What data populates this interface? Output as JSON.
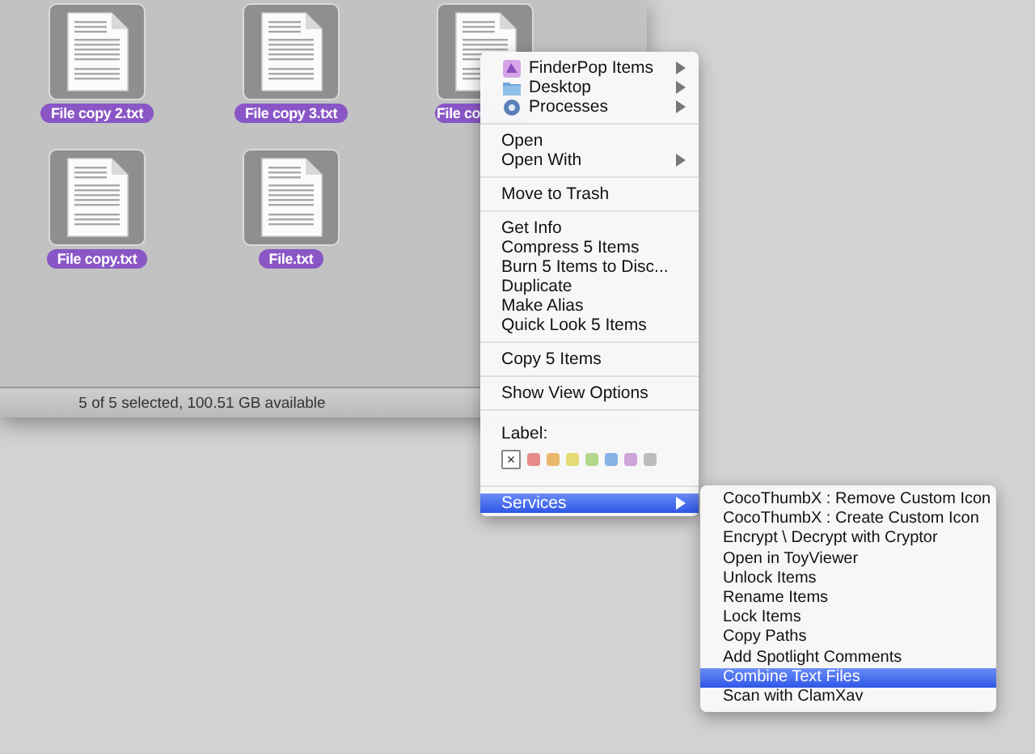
{
  "files": [
    {
      "name": "File copy 2.txt",
      "selected": true
    },
    {
      "name": "File copy 3.txt",
      "selected": true
    },
    {
      "name": "File co",
      "selected": true,
      "kind": "covered"
    },
    {
      "name": "File copy.txt",
      "selected": true
    },
    {
      "name": "File.txt",
      "selected": true
    }
  ],
  "status_bar": "5 of 5 selected, 100.51 GB available",
  "context_menu": {
    "sections": [
      [
        {
          "label": "FinderPop Items",
          "has_submenu": true,
          "selected": false
        },
        {
          "label": "Desktop",
          "has_submenu": true,
          "selected": false
        },
        {
          "label": "Processes",
          "has_submenu": true,
          "selected": false
        }
      ],
      [
        {
          "label": "Open",
          "has_submenu": false,
          "selected": false
        },
        {
          "label": "Open With",
          "has_submenu": true,
          "selected": false
        }
      ],
      [
        {
          "label": "Move to Trash",
          "has_submenu": false,
          "selected": false
        }
      ],
      [
        {
          "label": "Get Info",
          "has_submenu": false,
          "selected": false
        },
        {
          "label": "Compress 5 Items",
          "has_submenu": false,
          "selected": false
        },
        {
          "label": "Burn 5 Items to Disc...",
          "has_submenu": false,
          "selected": false
        },
        {
          "label": "Duplicate",
          "has_submenu": false,
          "selected": false
        },
        {
          "label": "Make Alias",
          "has_submenu": false,
          "selected": false
        },
        {
          "label": "Quick Look 5 Items",
          "has_submenu": false,
          "selected": false
        }
      ],
      [
        {
          "label": "Copy 5 Items",
          "has_submenu": false,
          "selected": false
        }
      ],
      [
        {
          "label": "Show View Options",
          "has_submenu": false,
          "selected": false
        }
      ]
    ],
    "label_heading": "Label:",
    "label_swatches": [
      {
        "kind": "none",
        "text": "×"
      },
      {
        "kind": "color",
        "color": "#e68a8a"
      },
      {
        "kind": "color",
        "color": "#e8b86c"
      },
      {
        "kind": "color",
        "color": "#e4dc74"
      },
      {
        "kind": "color",
        "color": "#b2d68a"
      },
      {
        "kind": "color",
        "color": "#86b2e4"
      },
      {
        "kind": "color",
        "color": "#d0a6da"
      },
      {
        "kind": "color",
        "color": "#bcbcbc"
      }
    ],
    "services": {
      "label": "Services",
      "has_submenu": true,
      "selected": true
    }
  },
  "services_menu": [
    {
      "label": "CocoThumbX : Remove Custom Icon",
      "selected": false
    },
    {
      "label": "CocoThumbX : Create Custom Icon",
      "selected": false
    },
    {
      "label": "Encrypt \\ Decrypt with Cryptor",
      "selected": false
    },
    {
      "label": "Open in ToyViewer",
      "selected": false
    },
    {
      "label": "Unlock Items",
      "selected": false
    },
    {
      "label": "Rename Items",
      "selected": false
    },
    {
      "label": "Lock Items",
      "selected": false
    },
    {
      "label": "Copy Paths",
      "selected": false
    },
    {
      "label": "Add Spotlight Comments",
      "selected": false
    },
    {
      "label": "Combine Text Files",
      "selected": true
    },
    {
      "label": "Scan with ClamXav",
      "selected": false
    }
  ]
}
